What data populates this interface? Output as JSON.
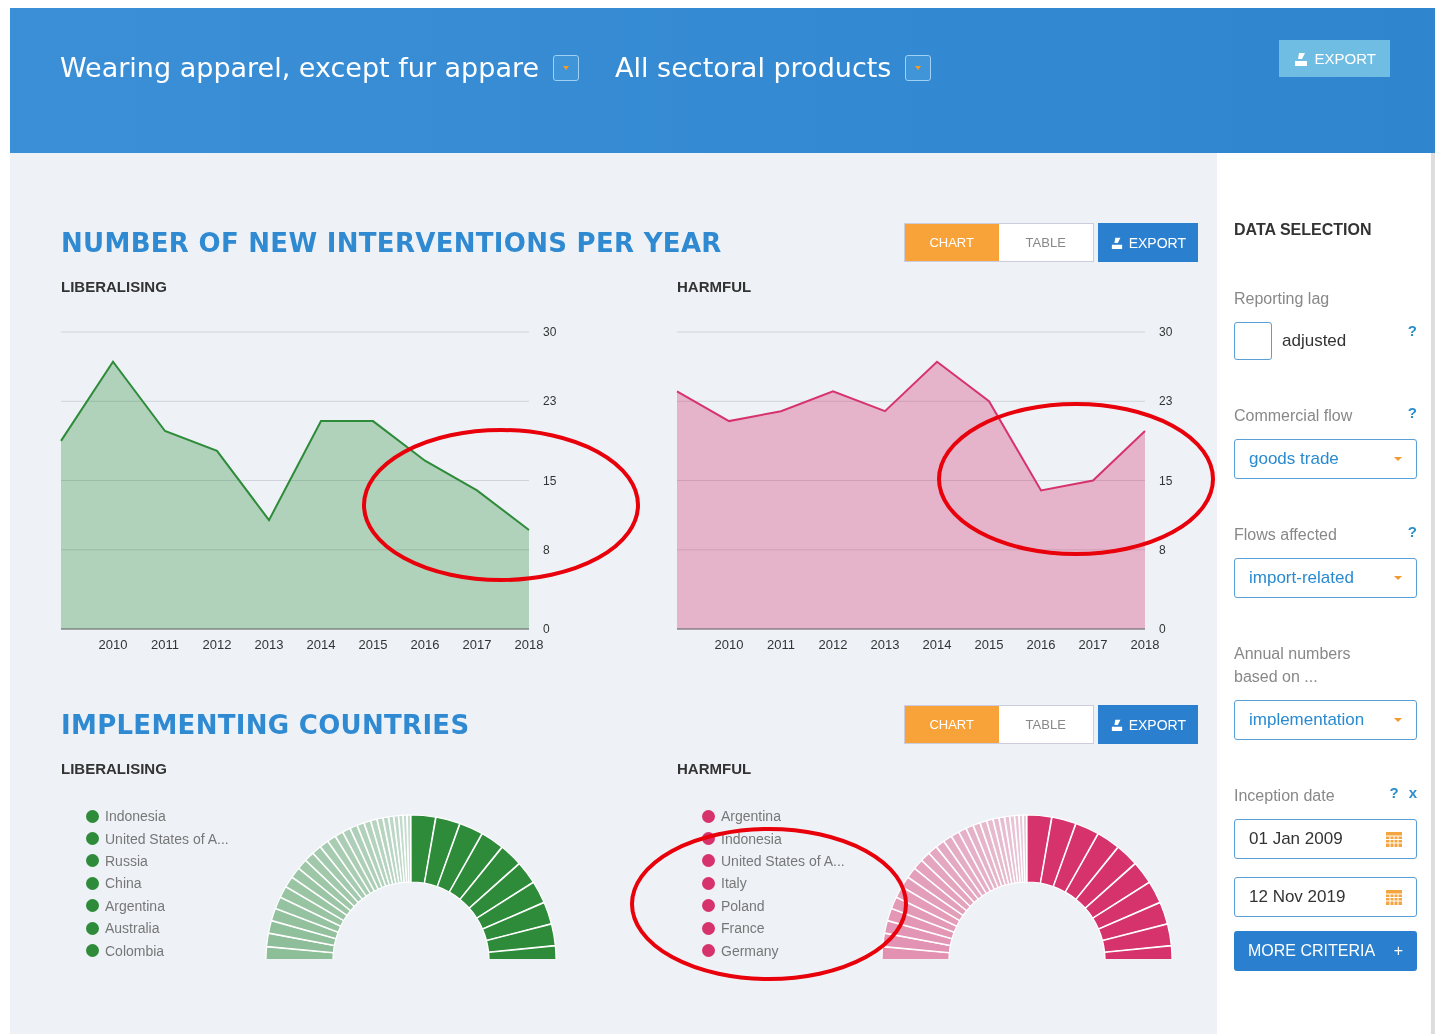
{
  "header": {
    "selectors": [
      {
        "value": "Wearing apparel, except fur appare"
      },
      {
        "value": "All sectoral products"
      }
    ],
    "export_button": "EXPORT"
  },
  "sections": [
    {
      "title": "NUMBER OF NEW INTERVENTIONS PER YEAR",
      "view_toggle": [
        {
          "label": "CHART",
          "selected": true
        },
        {
          "label": "TABLE",
          "selected": false
        }
      ],
      "export_button": "EXPORT",
      "panels": [
        {
          "heading": "LIBERALISING",
          "kind": "area",
          "chart_data": {
            "type": "area",
            "x": [
              2009,
              2010,
              2011,
              2012,
              2013,
              2014,
              2015,
              2016,
              2017,
              2018
            ],
            "series": [
              {
                "color": "#2e8b3a",
                "values": [
                  19,
                  27,
                  20,
                  18,
                  11,
                  21,
                  21,
                  17,
                  14,
                  10
                ]
              }
            ],
            "xticks": [
              2010,
              2011,
              2012,
              2013,
              2014,
              2015,
              2016,
              2017,
              2018
            ],
            "xlim": [
              2009,
              2018
            ],
            "yticks": [
              0,
              8,
              15,
              23,
              30
            ],
            "ylim": [
              0,
              30
            ],
            "grid": true
          }
        },
        {
          "heading": "HARMFUL",
          "kind": "area",
          "chart_data": {
            "type": "area",
            "x": [
              2009,
              2010,
              2011,
              2012,
              2013,
              2014,
              2015,
              2016,
              2017,
              2018
            ],
            "series": [
              {
                "color": "#d6336c",
                "values": [
                  24,
                  21,
                  22,
                  24,
                  22,
                  27,
                  23,
                  14,
                  15,
                  20
                ]
              }
            ],
            "xticks": [
              2010,
              2011,
              2012,
              2013,
              2014,
              2015,
              2016,
              2017,
              2018
            ],
            "xlim": [
              2009,
              2018
            ],
            "yticks": [
              0,
              8,
              15,
              23,
              30
            ],
            "ylim": [
              0,
              30
            ],
            "grid": true
          }
        }
      ]
    },
    {
      "title": "IMPLEMENTING COUNTRIES",
      "view_toggle": [
        {
          "label": "CHART",
          "selected": true
        },
        {
          "label": "TABLE",
          "selected": false
        }
      ],
      "export_button": "EXPORT",
      "panels": [
        {
          "heading": "LIBERALISING",
          "kind": "donut",
          "color": "#2e8b3a",
          "legend": [
            {
              "label": "Indonesia",
              "color": "#2e8b3a"
            },
            {
              "label": "United States of A...",
              "color": "#2e8b3a"
            },
            {
              "label": "Russia",
              "color": "#2e8b3a"
            },
            {
              "label": "China",
              "color": "#2e8b3a"
            },
            {
              "label": "Argentina",
              "color": "#2e8b3a"
            },
            {
              "label": "Australia",
              "color": "#2e8b3a"
            },
            {
              "label": "Colombia",
              "color": "#2e8b3a"
            }
          ]
        },
        {
          "heading": "HARMFUL",
          "kind": "donut",
          "color": "#d6336c",
          "legend": [
            {
              "label": "Argentina",
              "color": "#d6336c"
            },
            {
              "label": "Indonesia",
              "color": "#d6336c"
            },
            {
              "label": "United States of A...",
              "color": "#d6336c"
            },
            {
              "label": "Italy",
              "color": "#d6336c"
            },
            {
              "label": "Poland",
              "color": "#d6336c"
            },
            {
              "label": "France",
              "color": "#d6336c"
            },
            {
              "label": "Germany",
              "color": "#d6336c"
            }
          ]
        }
      ]
    }
  ],
  "sidebar": {
    "title": "DATA SELECTION",
    "filters": [
      {
        "kind": "checkbox",
        "label": "Reporting lag",
        "option": "adjusted",
        "checked": false,
        "help": "?"
      },
      {
        "kind": "select",
        "label": "Commercial flow",
        "value": "goods trade",
        "help": "?"
      },
      {
        "kind": "select",
        "label": "Flows affected",
        "value": "import-related",
        "help": "?"
      },
      {
        "kind": "select",
        "label": "Annual numbers based on ...",
        "value": "implementation"
      },
      {
        "kind": "dates",
        "label": "Inception date",
        "help": "?",
        "clear": "x",
        "values": [
          "01 Jan 2009",
          "12 Nov 2019"
        ]
      }
    ],
    "more_button": {
      "label": "MORE CRITERIA",
      "icon": "+"
    }
  }
}
